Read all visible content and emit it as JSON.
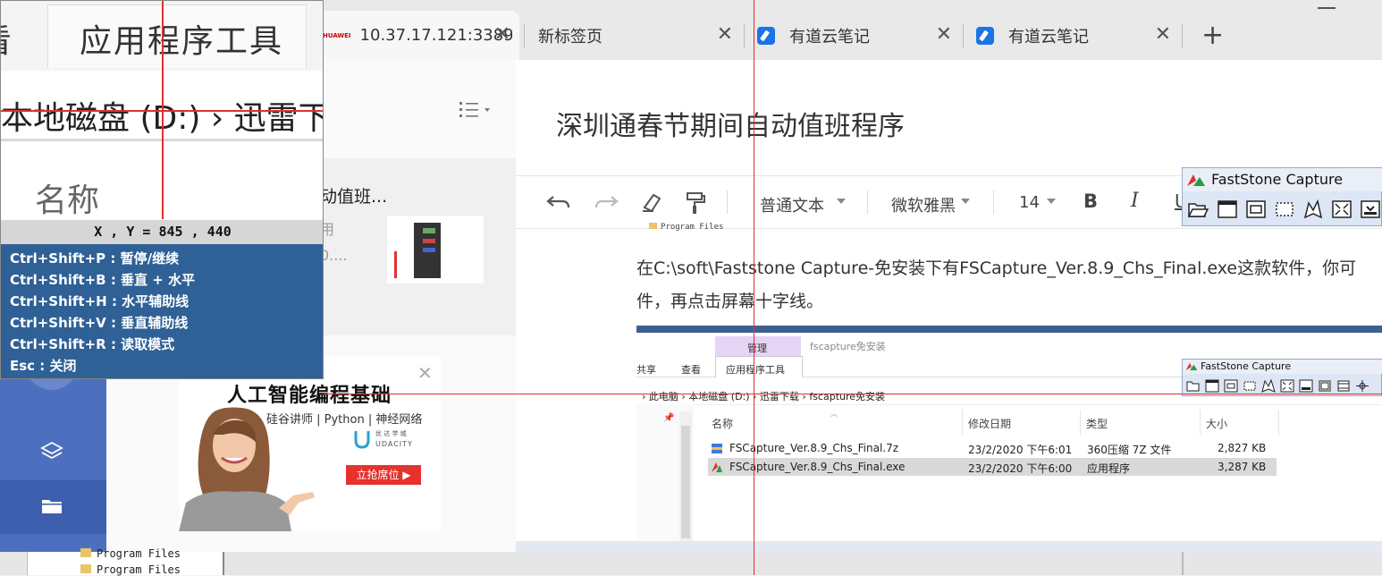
{
  "browser": {
    "tabs": [
      {
        "title": "10.37.17.121:3389",
        "brand": "HUAWEI"
      },
      {
        "title": "新标签页"
      },
      {
        "title": "有道云笔记"
      },
      {
        "title": "有道云笔记"
      }
    ],
    "close_glyph": "✕",
    "new_tab_glyph": "+"
  },
  "note_list": {
    "items": [
      {
        "title": "动值班...",
        "line1": "用",
        "line2": "0...."
      }
    ]
  },
  "ad": {
    "title": "人工智能编程基础",
    "subtitle": "硅谷讲师 | Python | 神经网络",
    "logo_line1": "优 达 学 城",
    "logo_line2": "UDACITY",
    "button": "立抢席位 ▶",
    "close": "✕"
  },
  "editor": {
    "doc_title": "深圳通春节期间自动值班程序",
    "toolbar": {
      "paragraph_style": "普通文本",
      "font": "微软雅黑",
      "font_size": "14",
      "bold": "B",
      "italic": "I",
      "underline": "U"
    },
    "embed_top_text": "Program Files",
    "body_line1": "在C:\\soft\\Faststone Capture-免安装下有FSCapture_Ver.8.9_Chs_Final.exe这款软件，你可",
    "body_line2": "件，再点击屏幕十字线。"
  },
  "embedded_explorer": {
    "manage_label": "管理",
    "folder_label": "fscapture免安装",
    "ribbon_tabs": [
      "共享",
      "查看",
      "应用程序工具"
    ],
    "breadcrumb": "› 此电脑 › 本地磁盘 (D:) › 迅雷下载 › fscapture免安装",
    "columns": [
      "名称",
      "修改日期",
      "类型",
      "大小"
    ],
    "files": [
      {
        "name": "FSCapture_Ver.8.9_Chs_Final.7z",
        "date": "23/2/2020 下午6:01",
        "type": "360压缩 7Z 文件",
        "size": "2,827 KB"
      },
      {
        "name": "FSCapture_Ver.8.9_Chs_Final.exe",
        "date": "23/2/2020 下午6:00",
        "type": "应用程序",
        "size": "3,287 KB"
      }
    ]
  },
  "magnifier": {
    "tab_label": "应用程序工具",
    "partial_tab": "看",
    "breadcrumb": "本地磁盘 (D:) › 迅雷下",
    "column_label": "名称",
    "coords": "X , Y = 845 , 440",
    "help": [
      "Ctrl+Shift+P : 暂停/继续",
      "Ctrl+Shift+B : 垂直 + 水平",
      "Ctrl+Shift+H : 水平辅助线",
      "Ctrl+Shift+V : 垂直辅助线",
      "Ctrl+Shift+R : 读取模式",
      "Esc : 关闭"
    ]
  },
  "faststone": {
    "title": "FastStone Capture",
    "title_small": "FastStone Capture"
  },
  "bottom": {
    "files": [
      "Program Files",
      "Program Files"
    ]
  },
  "colors": {
    "crosshair": "#e03030",
    "help_bg": "#2f6196",
    "sidebar_blue": "#4d6fbf",
    "ad_button": "#e5322d"
  },
  "icons": [
    "close-icon",
    "plus-icon",
    "youdao-note-icon",
    "list-view-icon",
    "undo-icon",
    "redo-icon",
    "eraser-icon",
    "format-painter-icon",
    "layers-icon",
    "folder-icon",
    "udacity-logo-icon",
    "faststone-logo-icon"
  ]
}
